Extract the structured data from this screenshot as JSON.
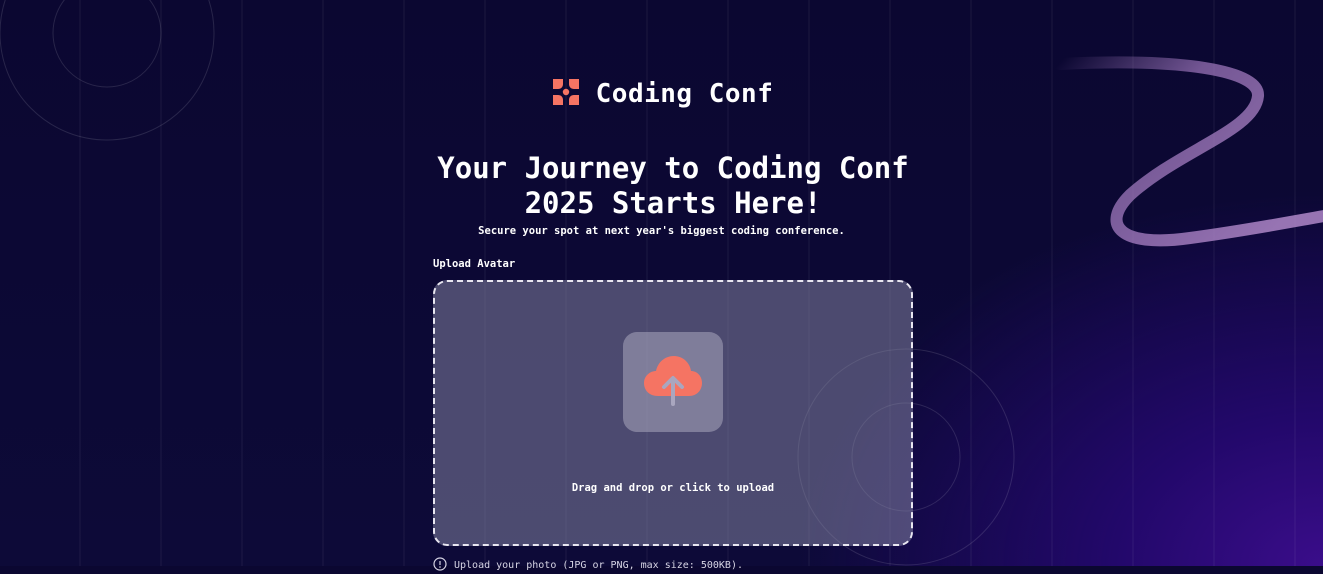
{
  "brand": {
    "name": "Coding Conf",
    "accent_color": "#f57463"
  },
  "hero": {
    "title": "Your Journey to Coding Conf 2025 Starts Here!",
    "subtitle": "Secure your spot at next year's biggest coding conference."
  },
  "form": {
    "avatar": {
      "label": "Upload Avatar",
      "dropzone_text": "Drag and drop or click to upload",
      "icon": "cloud-upload-icon",
      "hint_icon": "info-icon",
      "hint": "Upload your photo (JPG or PNG, max size: 500KB)."
    }
  },
  "colors": {
    "background": "#0d0a38",
    "background_glow": "#3a0d8a",
    "dropzone_border": "#e8e6f0"
  }
}
